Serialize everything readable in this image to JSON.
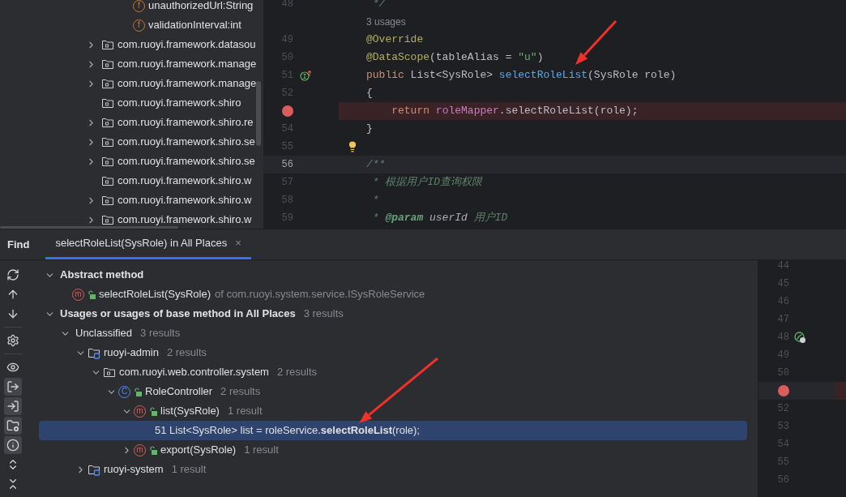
{
  "project_tree": [
    {
      "kind": "field",
      "badge": "f",
      "label": "unauthorizedUrl:String"
    },
    {
      "kind": "field",
      "badge": "f",
      "label": "validationInterval:int"
    },
    {
      "kind": "package",
      "label": "com.ruoyi.framework.datasou",
      "has_children": true
    },
    {
      "kind": "package",
      "label": "com.ruoyi.framework.manage",
      "has_children": true
    },
    {
      "kind": "package",
      "label": "com.ruoyi.framework.manage",
      "has_children": true
    },
    {
      "kind": "package",
      "label": "com.ruoyi.framework.shiro",
      "has_children": false
    },
    {
      "kind": "package",
      "label": "com.ruoyi.framework.shiro.re",
      "has_children": true
    },
    {
      "kind": "package",
      "label": "com.ruoyi.framework.shiro.se",
      "has_children": true
    },
    {
      "kind": "package",
      "label": "com.ruoyi.framework.shiro.se",
      "has_children": true
    },
    {
      "kind": "package",
      "label": "com.ruoyi.framework.shiro.w",
      "has_children": false
    },
    {
      "kind": "package",
      "label": "com.ruoyi.framework.shiro.w",
      "has_children": true
    },
    {
      "kind": "package",
      "label": "com.ruoyi.framework.shiro.w",
      "has_children": true
    }
  ],
  "editor": {
    "lines": [
      {
        "kind": "code",
        "number": "48",
        "breakpoint": false,
        "current": false,
        "tokens": [
          {
            "kind": "comment",
            "text": " */"
          }
        ]
      },
      {
        "kind": "inlay",
        "text": "3 usages"
      },
      {
        "kind": "code",
        "number": "49",
        "breakpoint": false,
        "current": false,
        "tokens": [
          {
            "kind": "annotation",
            "text": "@Override"
          }
        ]
      },
      {
        "kind": "code",
        "number": "50",
        "breakpoint": false,
        "current": false,
        "tokens": [
          {
            "kind": "annotation",
            "text": "@DataScope"
          },
          {
            "kind": "plain",
            "text": "(tableAlias = "
          },
          {
            "kind": "string",
            "text": "\"u\""
          },
          {
            "kind": "plain",
            "text": ")"
          }
        ]
      },
      {
        "kind": "code",
        "number": "51",
        "breakpoint": false,
        "current": false,
        "gutter_icon": {
          "kind": "implements"
        },
        "tokens": [
          {
            "kind": "keyword",
            "text": "public "
          },
          {
            "kind": "plain",
            "text": "List<SysRole> "
          },
          {
            "kind": "method",
            "text": "selectRoleList"
          },
          {
            "kind": "plain",
            "text": "(SysRole role)"
          }
        ]
      },
      {
        "kind": "code",
        "number": "52",
        "breakpoint": false,
        "current": false,
        "tokens": [
          {
            "kind": "plain",
            "text": "{"
          }
        ]
      },
      {
        "kind": "code",
        "breakpoint": true,
        "current": false,
        "tokens": [
          {
            "kind": "keyword",
            "text": "    return "
          },
          {
            "kind": "field",
            "text": "roleMapper"
          },
          {
            "kind": "plain",
            "text": ".selectRoleList(role);"
          }
        ]
      },
      {
        "kind": "code",
        "number": "54",
        "breakpoint": false,
        "current": false,
        "tokens": [
          {
            "kind": "plain",
            "text": "}"
          }
        ]
      },
      {
        "kind": "code",
        "number": "55",
        "breakpoint": false,
        "current": false,
        "hint_icon": {
          "kind": "bulb"
        }
      },
      {
        "kind": "code",
        "number": "56",
        "breakpoint": false,
        "current": true,
        "tokens": [
          {
            "kind": "comment",
            "text": "/**"
          }
        ]
      },
      {
        "kind": "code",
        "number": "57",
        "breakpoint": false,
        "current": false,
        "tokens": [
          {
            "kind": "comment",
            "text": " * 根据用户ID查询权限"
          }
        ]
      },
      {
        "kind": "code",
        "number": "58",
        "breakpoint": false,
        "current": false,
        "tokens": [
          {
            "kind": "comment",
            "text": " *"
          }
        ]
      },
      {
        "kind": "code",
        "number": "59",
        "breakpoint": false,
        "current": false,
        "tokens": [
          {
            "kind": "comment",
            "text": " * "
          },
          {
            "kind": "doctag",
            "text": "@param"
          },
          {
            "kind": "docparam",
            "text": " userId"
          },
          {
            "kind": "comment",
            "text": " 用户ID"
          }
        ]
      }
    ]
  },
  "find": {
    "title": "Find",
    "tabs": [
      {
        "label": "selectRoleList(SysRole) in All Places",
        "close": "×",
        "selected": true
      }
    ],
    "toolbar": [
      {
        "kind": "rerun",
        "on": false
      },
      {
        "kind": "up",
        "on": false
      },
      {
        "kind": "down",
        "on": false
      },
      {
        "kind": "separator"
      },
      {
        "kind": "settings",
        "on": false
      },
      {
        "kind": "separator"
      },
      {
        "kind": "preview",
        "on": false
      },
      {
        "kind": "read",
        "on": true
      },
      {
        "kind": "write",
        "on": true
      },
      {
        "kind": "module",
        "on": true
      },
      {
        "kind": "info",
        "on": true
      },
      {
        "kind": "expand",
        "on": false
      },
      {
        "kind": "collapse",
        "on": false
      }
    ],
    "results": [
      {
        "kind": "group",
        "label": "Abstract method",
        "expanded": true,
        "selected": false,
        "children": [
          {
            "kind": "method",
            "badge": "m",
            "label": "selectRoleList(SysRole)",
            "detail": "of com.ruoyi.system.service.ISysRoleService",
            "selected": false
          }
        ]
      },
      {
        "kind": "group",
        "label": "Usages or usages of base method in All Places",
        "count": "3 results",
        "expanded": true,
        "selected": false,
        "children": [
          {
            "kind": "plain",
            "label": "Unclassified",
            "count": "3 results",
            "expanded": true,
            "selected": false,
            "children": [
              {
                "kind": "module",
                "label": "ruoyi-admin",
                "count": "2 results",
                "expanded": true,
                "selected": false,
                "children": [
                  {
                    "kind": "package",
                    "label": "com.ruoyi.web.controller.system",
                    "count": "2 results",
                    "expanded": true,
                    "selected": false,
                    "children": [
                      {
                        "kind": "class",
                        "badge": "C",
                        "label": "RoleController",
                        "count": "2 results",
                        "expanded": true,
                        "selected": false,
                        "children": [
                          {
                            "kind": "method",
                            "badge": "m",
                            "label": "list(SysRole)",
                            "count": "1 result",
                            "expanded": true,
                            "selected": false,
                            "children": [
                              {
                                "kind": "usage",
                                "label": "51 List<SysRole> list = roleService.**selectRoleList**(role);",
                                "selected": true
                              }
                            ]
                          },
                          {
                            "kind": "method",
                            "badge": "m",
                            "label": "export(SysRole)",
                            "count": "1 result",
                            "expanded": false,
                            "selected": false
                          }
                        ]
                      }
                    ]
                  }
                ]
              },
              {
                "kind": "module",
                "label": "ruoyi-system",
                "count": "1 result",
                "expanded": false,
                "selected": false
              }
            ]
          }
        ]
      }
    ]
  },
  "preview": {
    "lines": [
      {
        "number": "44",
        "breakpoint": false
      },
      {
        "number": "45",
        "breakpoint": false
      },
      {
        "number": "46",
        "breakpoint": false
      },
      {
        "number": "47",
        "breakpoint": false
      },
      {
        "number": "48",
        "breakpoint": false,
        "gutter_icon": {
          "kind": "bean"
        }
      },
      {
        "number": "49",
        "breakpoint": false
      },
      {
        "number": "50",
        "breakpoint": false
      },
      {
        "breakpoint": true
      },
      {
        "number": "52",
        "breakpoint": false
      },
      {
        "number": "53",
        "breakpoint": false
      },
      {
        "number": "54",
        "breakpoint": false
      },
      {
        "number": "55",
        "breakpoint": false
      },
      {
        "number": "56",
        "breakpoint": false
      }
    ]
  }
}
